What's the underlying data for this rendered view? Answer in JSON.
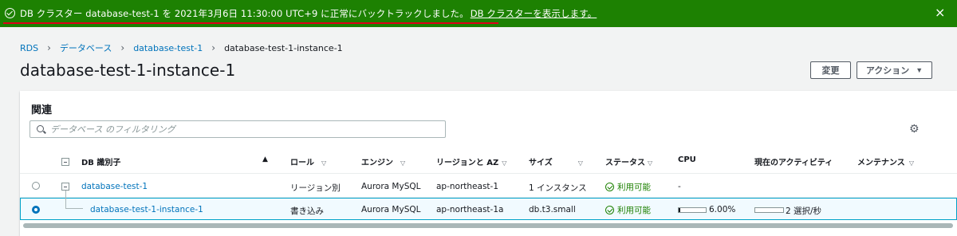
{
  "flash": {
    "message": "DB クラスター database-test-1 を 2021年3月6日 11:30:00 UTC+9 に正常にバックトラックしました。",
    "link": "DB クラスターを表示します。",
    "close": "×"
  },
  "breadcrumb": {
    "items": [
      "RDS",
      "データベース",
      "database-test-1"
    ],
    "current": "database-test-1-instance-1",
    "separator": "›"
  },
  "page": {
    "title": "database-test-1-instance-1"
  },
  "buttons": {
    "modify": "変更",
    "actions": "アクション",
    "actions_caret": "▼"
  },
  "panel": {
    "title": "関連",
    "search_placeholder": "データベース のフィルタリング",
    "settings_icon": "⚙"
  },
  "table": {
    "columns": {
      "db_id": "DB 識別子",
      "role": "ロール",
      "engine": "エンジン",
      "region_az": "リージョンと AZ",
      "size": "サイズ",
      "status": "ステータス",
      "cpu": "CPU",
      "activity": "現在のアクティビティ",
      "maintenance": "メンテナンス"
    },
    "sort_asc": "▲",
    "sort_icon": "▽",
    "rows": [
      {
        "db_id": "database-test-1",
        "role": "リージョン別",
        "engine": "Aurora MySQL",
        "region_az": "ap-northeast-1",
        "size": "1 インスタンス",
        "status": "利用可能",
        "cpu": "-",
        "selected": false
      },
      {
        "db_id": "database-test-1-instance-1",
        "role": "書き込み",
        "engine": "Aurora MySQL",
        "region_az": "ap-northeast-1a",
        "size": "db.t3.small",
        "status": "利用可能",
        "cpu": "6.00%",
        "cpu_fraction": 0.06,
        "activity": "2 選択/秒",
        "activity_fraction": 0.0,
        "selected": true
      }
    ]
  },
  "colors": {
    "success": "#1d8102",
    "link": "#0073bb",
    "selected_border": "#00a1c9"
  }
}
